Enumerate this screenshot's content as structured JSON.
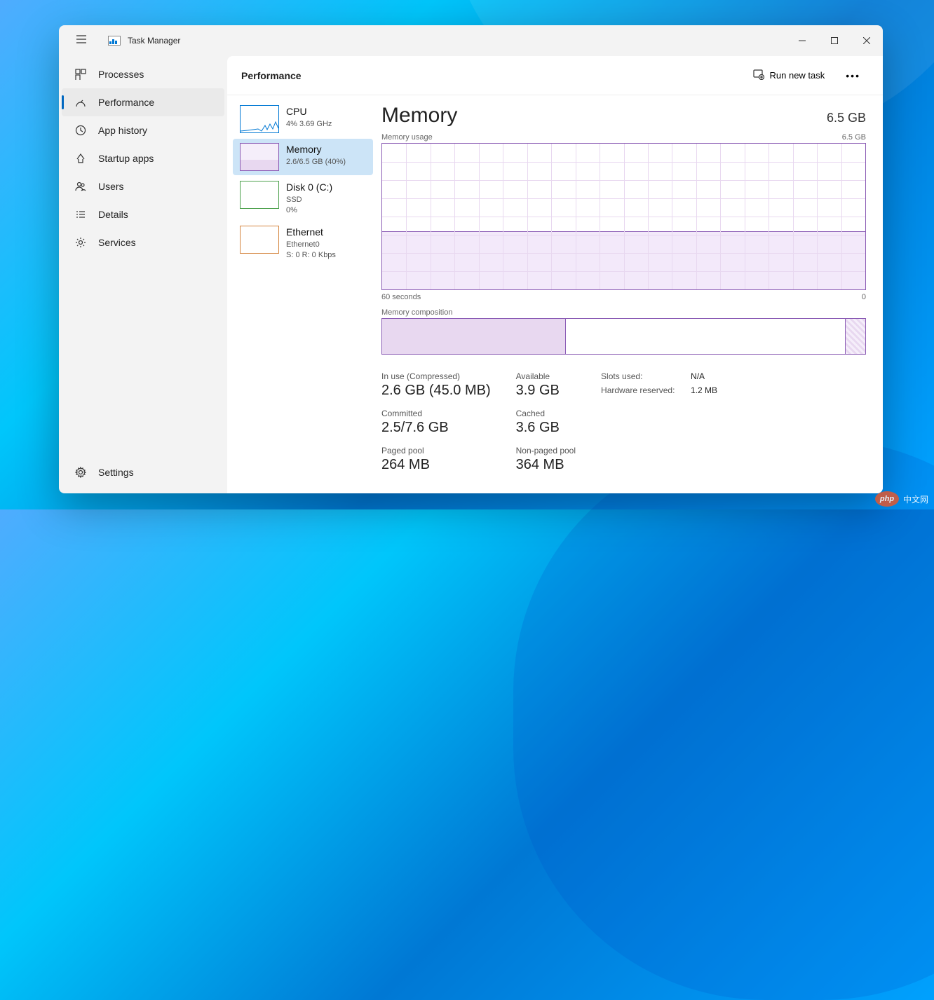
{
  "app": {
    "title": "Task Manager"
  },
  "window_controls": {
    "min": "minimize",
    "max": "maximize",
    "close": "close"
  },
  "nav": {
    "items": [
      {
        "label": "Processes"
      },
      {
        "label": "Performance"
      },
      {
        "label": "App history"
      },
      {
        "label": "Startup apps"
      },
      {
        "label": "Users"
      },
      {
        "label": "Details"
      },
      {
        "label": "Services"
      }
    ],
    "active_index": 1,
    "settings_label": "Settings"
  },
  "header": {
    "page_title": "Performance",
    "run_task_label": "Run new task"
  },
  "mini": {
    "items": [
      {
        "title": "CPU",
        "sub": "4%  3.69 GHz",
        "type": "cpu"
      },
      {
        "title": "Memory",
        "sub": "2.6/6.5 GB (40%)",
        "type": "mem"
      },
      {
        "title": "Disk 0 (C:)",
        "sub1": "SSD",
        "sub2": "0%",
        "type": "disk"
      },
      {
        "title": "Ethernet",
        "sub1": "Ethernet0",
        "sub2": "S: 0 R: 0 Kbps",
        "type": "eth"
      }
    ],
    "selected_index": 1
  },
  "detail": {
    "title": "Memory",
    "total": "6.5 GB",
    "usage_graph": {
      "label": "Memory usage",
      "max_label": "6.5 GB",
      "x_start": "60 seconds",
      "x_end": "0",
      "fill_percent": 40
    },
    "composition": {
      "label": "Memory composition",
      "used_percent": 38,
      "hw_percent": 4
    },
    "stats": {
      "in_use": {
        "label": "In use (Compressed)",
        "value": "2.6 GB (45.0 MB)"
      },
      "available": {
        "label": "Available",
        "value": "3.9 GB"
      },
      "committed": {
        "label": "Committed",
        "value": "2.5/7.6 GB"
      },
      "cached": {
        "label": "Cached",
        "value": "3.6 GB"
      },
      "paged": {
        "label": "Paged pool",
        "value": "264 MB"
      },
      "nonpaged": {
        "label": "Non-paged pool",
        "value": "364 MB"
      }
    },
    "sys": {
      "slots": {
        "label": "Slots used:",
        "value": "N/A"
      },
      "hw_reserved": {
        "label": "Hardware reserved:",
        "value": "1.2 MB"
      }
    }
  },
  "chart_data": {
    "type": "area",
    "title": "Memory usage",
    "x_range_seconds": [
      60,
      0
    ],
    "ylim": [
      0,
      6.5
    ],
    "ylabel": "GB",
    "current_value_gb": 2.6,
    "fill_percent": 40,
    "composition_segments": [
      {
        "name": "In use",
        "percent": 38
      },
      {
        "name": "Available",
        "percent": 58
      },
      {
        "name": "Hardware reserved",
        "percent": 4
      }
    ]
  },
  "watermark": {
    "badge": "php",
    "text": "中文网"
  }
}
